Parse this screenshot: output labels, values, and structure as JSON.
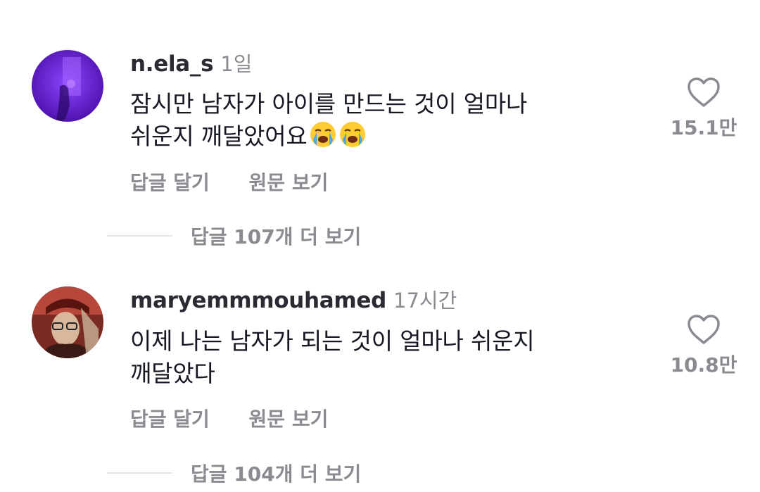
{
  "comments": [
    {
      "username": "n.ela_s",
      "time": "1일",
      "text_line1": "잠시만 남자가 아이를 만드는 것이 얼마나",
      "text_line2": "쉬운지 깨달았어요",
      "emoji": "loudly-crying-face-icon",
      "emoji_count": 2,
      "likes": "15.1만",
      "reply_label": "답글 달기",
      "original_label": "원문 보기",
      "more_replies": "답글 107개 더 보기"
    },
    {
      "username": "maryemmmouhamed",
      "time": "17시간",
      "text_line1": "이제 나는 남자가 되는 것이 얼마나 쉬운지",
      "text_line2": "깨달았다",
      "likes": "10.8만",
      "reply_label": "답글 달기",
      "original_label": "원문 보기",
      "more_replies": "답글 104개 더 보기"
    }
  ],
  "colors": {
    "primary_text": "#161823",
    "secondary_text": "#8a8b91",
    "divider": "#e3e3e6",
    "avatar1_purple": "#6a1fd1",
    "avatar2_red": "#9c2a22"
  },
  "icons": {
    "like": "heart-outline-icon"
  }
}
